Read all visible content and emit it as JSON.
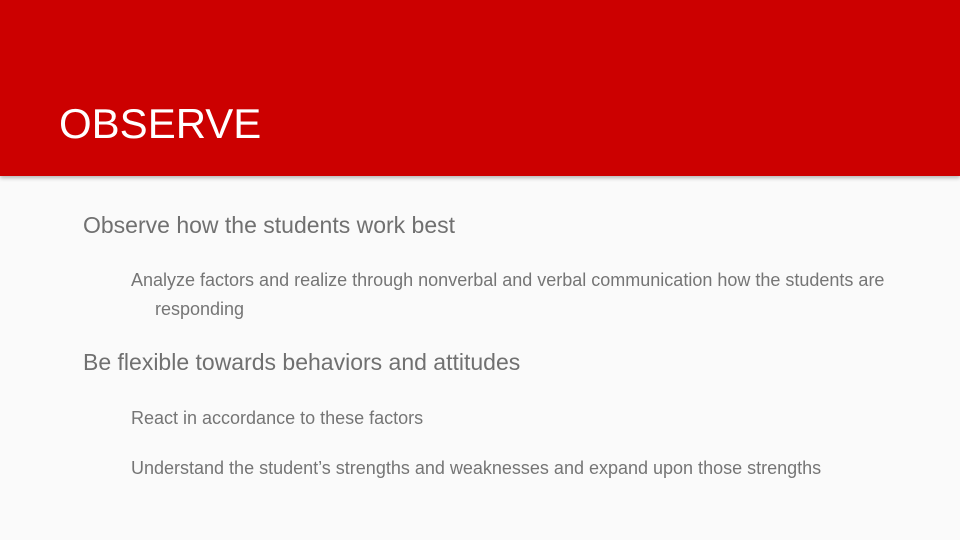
{
  "slide": {
    "title": "OBSERVE",
    "bullets": [
      {
        "text": "Observe how the students work best",
        "sub": [
          "Analyze factors and realize through nonverbal and verbal communication how the students are responding"
        ]
      },
      {
        "text": "Be flexible towards behaviors and attitudes",
        "sub": [
          "React in accordance to these factors",
          "Understand the student’s strengths and weaknesses and expand upon those strengths"
        ]
      }
    ]
  },
  "colors": {
    "header_band": "#cc0000",
    "title_text": "#ffffff",
    "background": "#fafafa",
    "body_text": "#757575"
  }
}
